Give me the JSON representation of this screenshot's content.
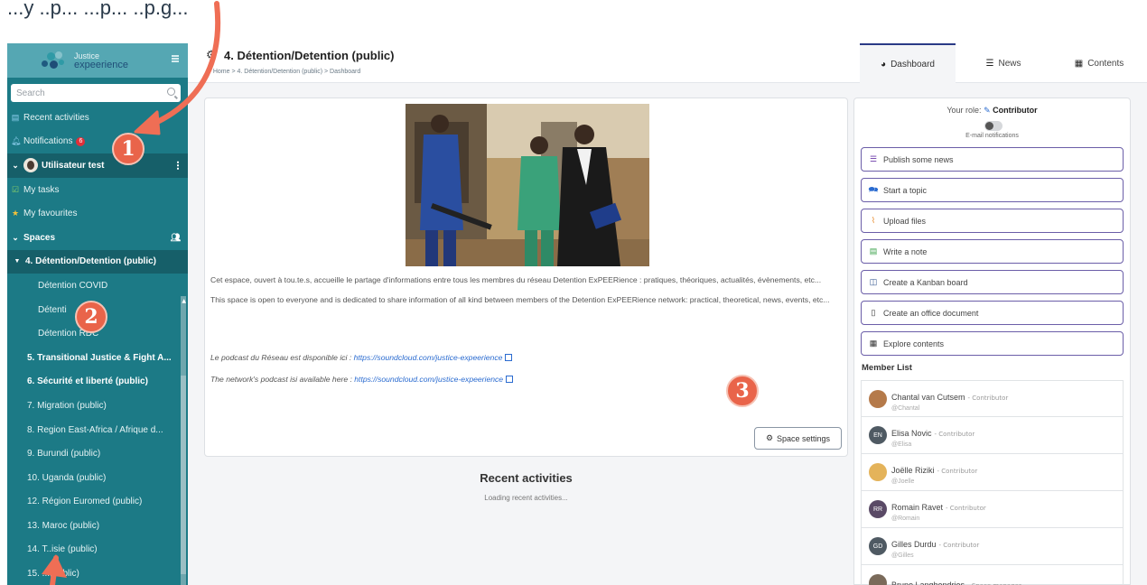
{
  "caption": {
    "text": "...y ..p... ...p... ..p.g..."
  },
  "sidebar": {
    "logo_line1": "Justice",
    "logo_line2": "expeerience",
    "search_placeholder": "Search",
    "recent_activities": "Recent activities",
    "notifications": "Notifications",
    "notifications_count": "6",
    "user_name": "Utilisateur test",
    "my_tasks": "My tasks",
    "my_favourites": "My favourites",
    "spaces_header": "Spaces",
    "current_space": "4. Détention/Detention (public)",
    "sub_spaces": [
      "Détention COVID",
      "Détenti",
      "Détention RDC"
    ],
    "spaces": [
      {
        "label": "5. Transitional Justice & Fight A...",
        "bold": true
      },
      {
        "label": "6. Sécurité et liberté (public)",
        "bold": true
      },
      {
        "label": "7. Migration (public)",
        "bold": false
      },
      {
        "label": "8. Region East-Africa / Afrique d...",
        "bold": false
      },
      {
        "label": "9. Burundi (public)",
        "bold": false
      },
      {
        "label": "10. Uganda (public)",
        "bold": false
      },
      {
        "label": "12. Région Euromed (public)",
        "bold": false
      },
      {
        "label": "13. Maroc (public)",
        "bold": false
      },
      {
        "label": "14. T..isie (public)",
        "bold": false
      },
      {
        "label": "15. ...(public)",
        "bold": false
      }
    ]
  },
  "header": {
    "title": "4. Détention/Detention (public)",
    "breadcrumb": "Home > 4. Détention/Detention (public) > Dashboard",
    "tabs": [
      "Dashboard",
      "News",
      "Contents"
    ]
  },
  "main": {
    "description_fr": "Cet espace, ouvert à tou.te.s, accueille le partage d'informations entre tous les membres du réseau Detention ExPEERience : pratiques, théoriques, actualités, évènements, etc...",
    "description_en": "This space is open to everyone and is dedicated to share information of all kind between members of the Detention ExPEERience network: practical, theoretical, news, events, etc...",
    "podcast_fr_label": "Le podcast du Réseau est disponible ici : ",
    "podcast_fr_link": "https://soundcloud.com/justice-expeerience",
    "podcast_en_label": "The network's podcast isi available here : ",
    "podcast_en_link": "https://soundcloud.com/justice-expeerience",
    "space_settings": "Space settings",
    "recent_activities_title": "Recent activities",
    "loading_text": "Loading recent activities..."
  },
  "right": {
    "role_label": "Your role:",
    "role_value": "Contributor",
    "email_notifications": "E-mail notifications",
    "actions": [
      "Publish some news",
      "Start a topic",
      "Upload files",
      "Write a note",
      "Create a Kanban board",
      "Create an office document",
      "Explore contents"
    ],
    "member_list_title": "Member List",
    "members": [
      {
        "name": "Chantal van Cutsem",
        "role": "- Contributor",
        "handle": "@Chantal",
        "initials": "",
        "avatar_color": "#b57a4a"
      },
      {
        "name": "Elisa Novic",
        "role": "- Contributor",
        "handle": "@Elisa",
        "initials": "EN",
        "avatar_color": "#4f5a63"
      },
      {
        "name": "Joëlle Riziki",
        "role": "- Contributor",
        "handle": "@Joelle",
        "initials": "",
        "avatar_color": "#e4b35a"
      },
      {
        "name": "Romain Ravet",
        "role": "- Contributor",
        "handle": "@Romain",
        "initials": "RR",
        "avatar_color": "#5a4a66"
      },
      {
        "name": "Gilles Durdu",
        "role": "- Contributor",
        "handle": "@Gilles",
        "initials": "GD",
        "avatar_color": "#4f5a63"
      },
      {
        "name": "Bruno Langhendries",
        "role": "- Space manager",
        "handle": "",
        "initials": "",
        "avatar_color": "#7a6a5a"
      }
    ]
  },
  "overlay_numbers": [
    "1",
    "2",
    "3"
  ],
  "colors": {
    "sidebar": "#1c7a86",
    "accent": "#e9644a",
    "link": "#2a6bd0",
    "action_border": "#6b5ea8"
  }
}
